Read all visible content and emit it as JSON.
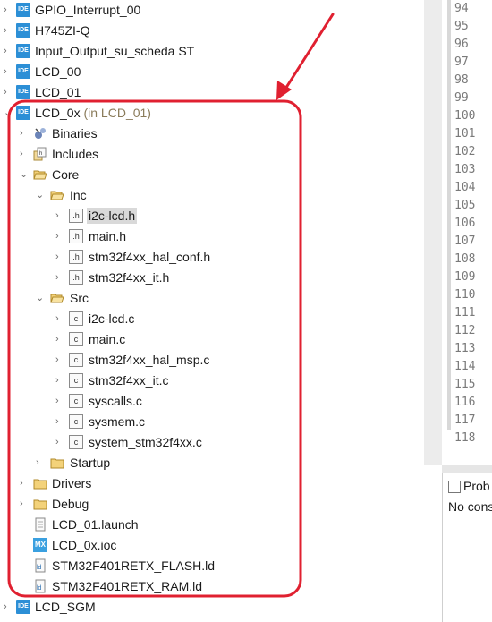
{
  "tree": {
    "items": [
      {
        "label": "GPIO_Interrupt_00",
        "icon": "ide-project-icon"
      },
      {
        "label": "H745ZI-Q",
        "icon": "ide-project-icon"
      },
      {
        "label": "Input_Output_su_scheda ST",
        "icon": "ide-project-icon"
      },
      {
        "label": "LCD_00",
        "icon": "ide-project-icon"
      },
      {
        "label": "LCD_01",
        "icon": "ide-project-icon"
      },
      {
        "label": "LCD_0x",
        "hint": "(in LCD_01)",
        "icon": "ide-project-icon",
        "expanded": true
      },
      {
        "label": "Binaries",
        "icon": "binaries-icon"
      },
      {
        "label": "Includes",
        "icon": "includes-icon"
      },
      {
        "label": "Core",
        "icon": "folder-icon",
        "expanded": true
      },
      {
        "label": "Inc",
        "icon": "folder-icon",
        "expanded": true
      },
      {
        "label": "i2c-lcd.h",
        "icon": "header-file-icon",
        "selected": true
      },
      {
        "label": "main.h",
        "icon": "header-file-icon"
      },
      {
        "label": "stm32f4xx_hal_conf.h",
        "icon": "header-file-icon"
      },
      {
        "label": "stm32f4xx_it.h",
        "icon": "header-file-icon"
      },
      {
        "label": "Src",
        "icon": "folder-icon",
        "expanded": true
      },
      {
        "label": "i2c-lcd.c",
        "icon": "c-file-icon"
      },
      {
        "label": "main.c",
        "icon": "c-file-icon"
      },
      {
        "label": "stm32f4xx_hal_msp.c",
        "icon": "c-file-icon"
      },
      {
        "label": "stm32f4xx_it.c",
        "icon": "c-file-icon"
      },
      {
        "label": "syscalls.c",
        "icon": "c-file-icon"
      },
      {
        "label": "sysmem.c",
        "icon": "c-file-icon"
      },
      {
        "label": "system_stm32f4xx.c",
        "icon": "c-file-icon"
      },
      {
        "label": "Startup",
        "icon": "folder-icon"
      },
      {
        "label": "Drivers",
        "icon": "folder-icon"
      },
      {
        "label": "Debug",
        "icon": "folder-icon"
      },
      {
        "label": "LCD_01.launch",
        "icon": "launch-file-icon"
      },
      {
        "label": "LCD_0x.ioc",
        "icon": "mx-file-icon"
      },
      {
        "label": "STM32F401RETX_FLASH.ld",
        "icon": "linker-file-icon"
      },
      {
        "label": "STM32F401RETX_RAM.ld",
        "icon": "linker-file-icon"
      },
      {
        "label": "LCD_SGM",
        "icon": "ide-project-icon"
      }
    ]
  },
  "editor": {
    "line_numbers": [
      "94",
      "95",
      "96",
      "97",
      "98",
      "99",
      "100",
      "101",
      "102",
      "103",
      "104",
      "105",
      "106",
      "107",
      "108",
      "109",
      "110",
      "111",
      "112",
      "113",
      "114",
      "115",
      "116",
      "117",
      "118"
    ]
  },
  "panel": {
    "tab_label": "Prob",
    "message": "No cons"
  },
  "colors": {
    "annotation": "#e02030",
    "ide_badge": "#2c8fd6",
    "folder": "#e8c46a"
  }
}
